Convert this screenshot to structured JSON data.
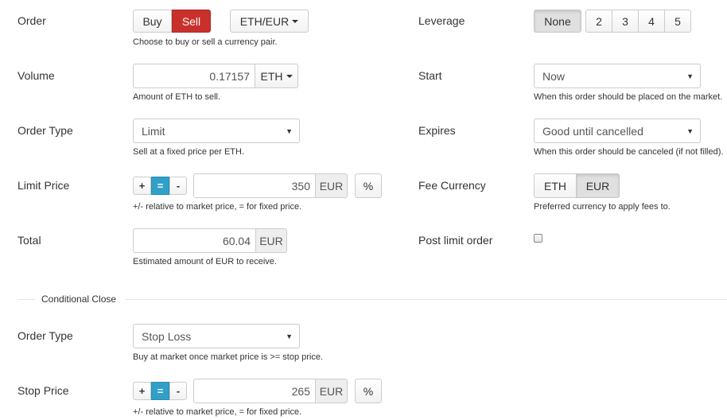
{
  "left": {
    "order": {
      "label": "Order",
      "buy": "Buy",
      "sell": "Sell",
      "pair": "ETH/EUR",
      "help": "Choose to buy or sell a currency pair."
    },
    "volume": {
      "label": "Volume",
      "value": "0.17157",
      "unit": "ETH",
      "help": "Amount of ETH to sell."
    },
    "order_type": {
      "label": "Order Type",
      "value": "Limit",
      "help": "Sell at a fixed price per ETH."
    },
    "limit_price": {
      "label": "Limit Price",
      "plus": "+",
      "eq": "=",
      "minus": "-",
      "value": "350",
      "unit": "EUR",
      "percent": "%",
      "help": "+/- relative to market price, = for fixed price."
    },
    "total": {
      "label": "Total",
      "value": "60.04",
      "unit": "EUR",
      "help": "Estimated amount of EUR to receive."
    }
  },
  "right": {
    "leverage": {
      "label": "Leverage",
      "options": [
        "None",
        "2",
        "3",
        "4",
        "5"
      ],
      "selected": "None"
    },
    "start": {
      "label": "Start",
      "value": "Now",
      "help": "When this order should be placed on the market."
    },
    "expires": {
      "label": "Expires",
      "value": "Good until cancelled",
      "help": "When this order should be canceled (if not filled)."
    },
    "fee_currency": {
      "label": "Fee Currency",
      "eth": "ETH",
      "eur": "EUR",
      "selected": "EUR",
      "help": "Preferred currency to apply fees to."
    },
    "post_limit": {
      "label": "Post limit order",
      "checked": false
    }
  },
  "conditional_close": {
    "title": "Conditional Close",
    "order_type": {
      "label": "Order Type",
      "value": "Stop Loss",
      "help": "Buy at market once market price is >= stop price."
    },
    "stop_price": {
      "label": "Stop Price",
      "plus": "+",
      "eq": "=",
      "minus": "-",
      "value": "265",
      "unit": "EUR",
      "percent": "%",
      "help": "+/- relative to market price, = for fixed price."
    }
  },
  "colors": {
    "sell": "#c9302c",
    "equals": "#31a0c9",
    "active_gray": "#e0e0e0"
  },
  "icons": {
    "dropdown": "caret-down-icon",
    "select": "select-arrow-icon",
    "checkbox": "checkbox-icon"
  }
}
